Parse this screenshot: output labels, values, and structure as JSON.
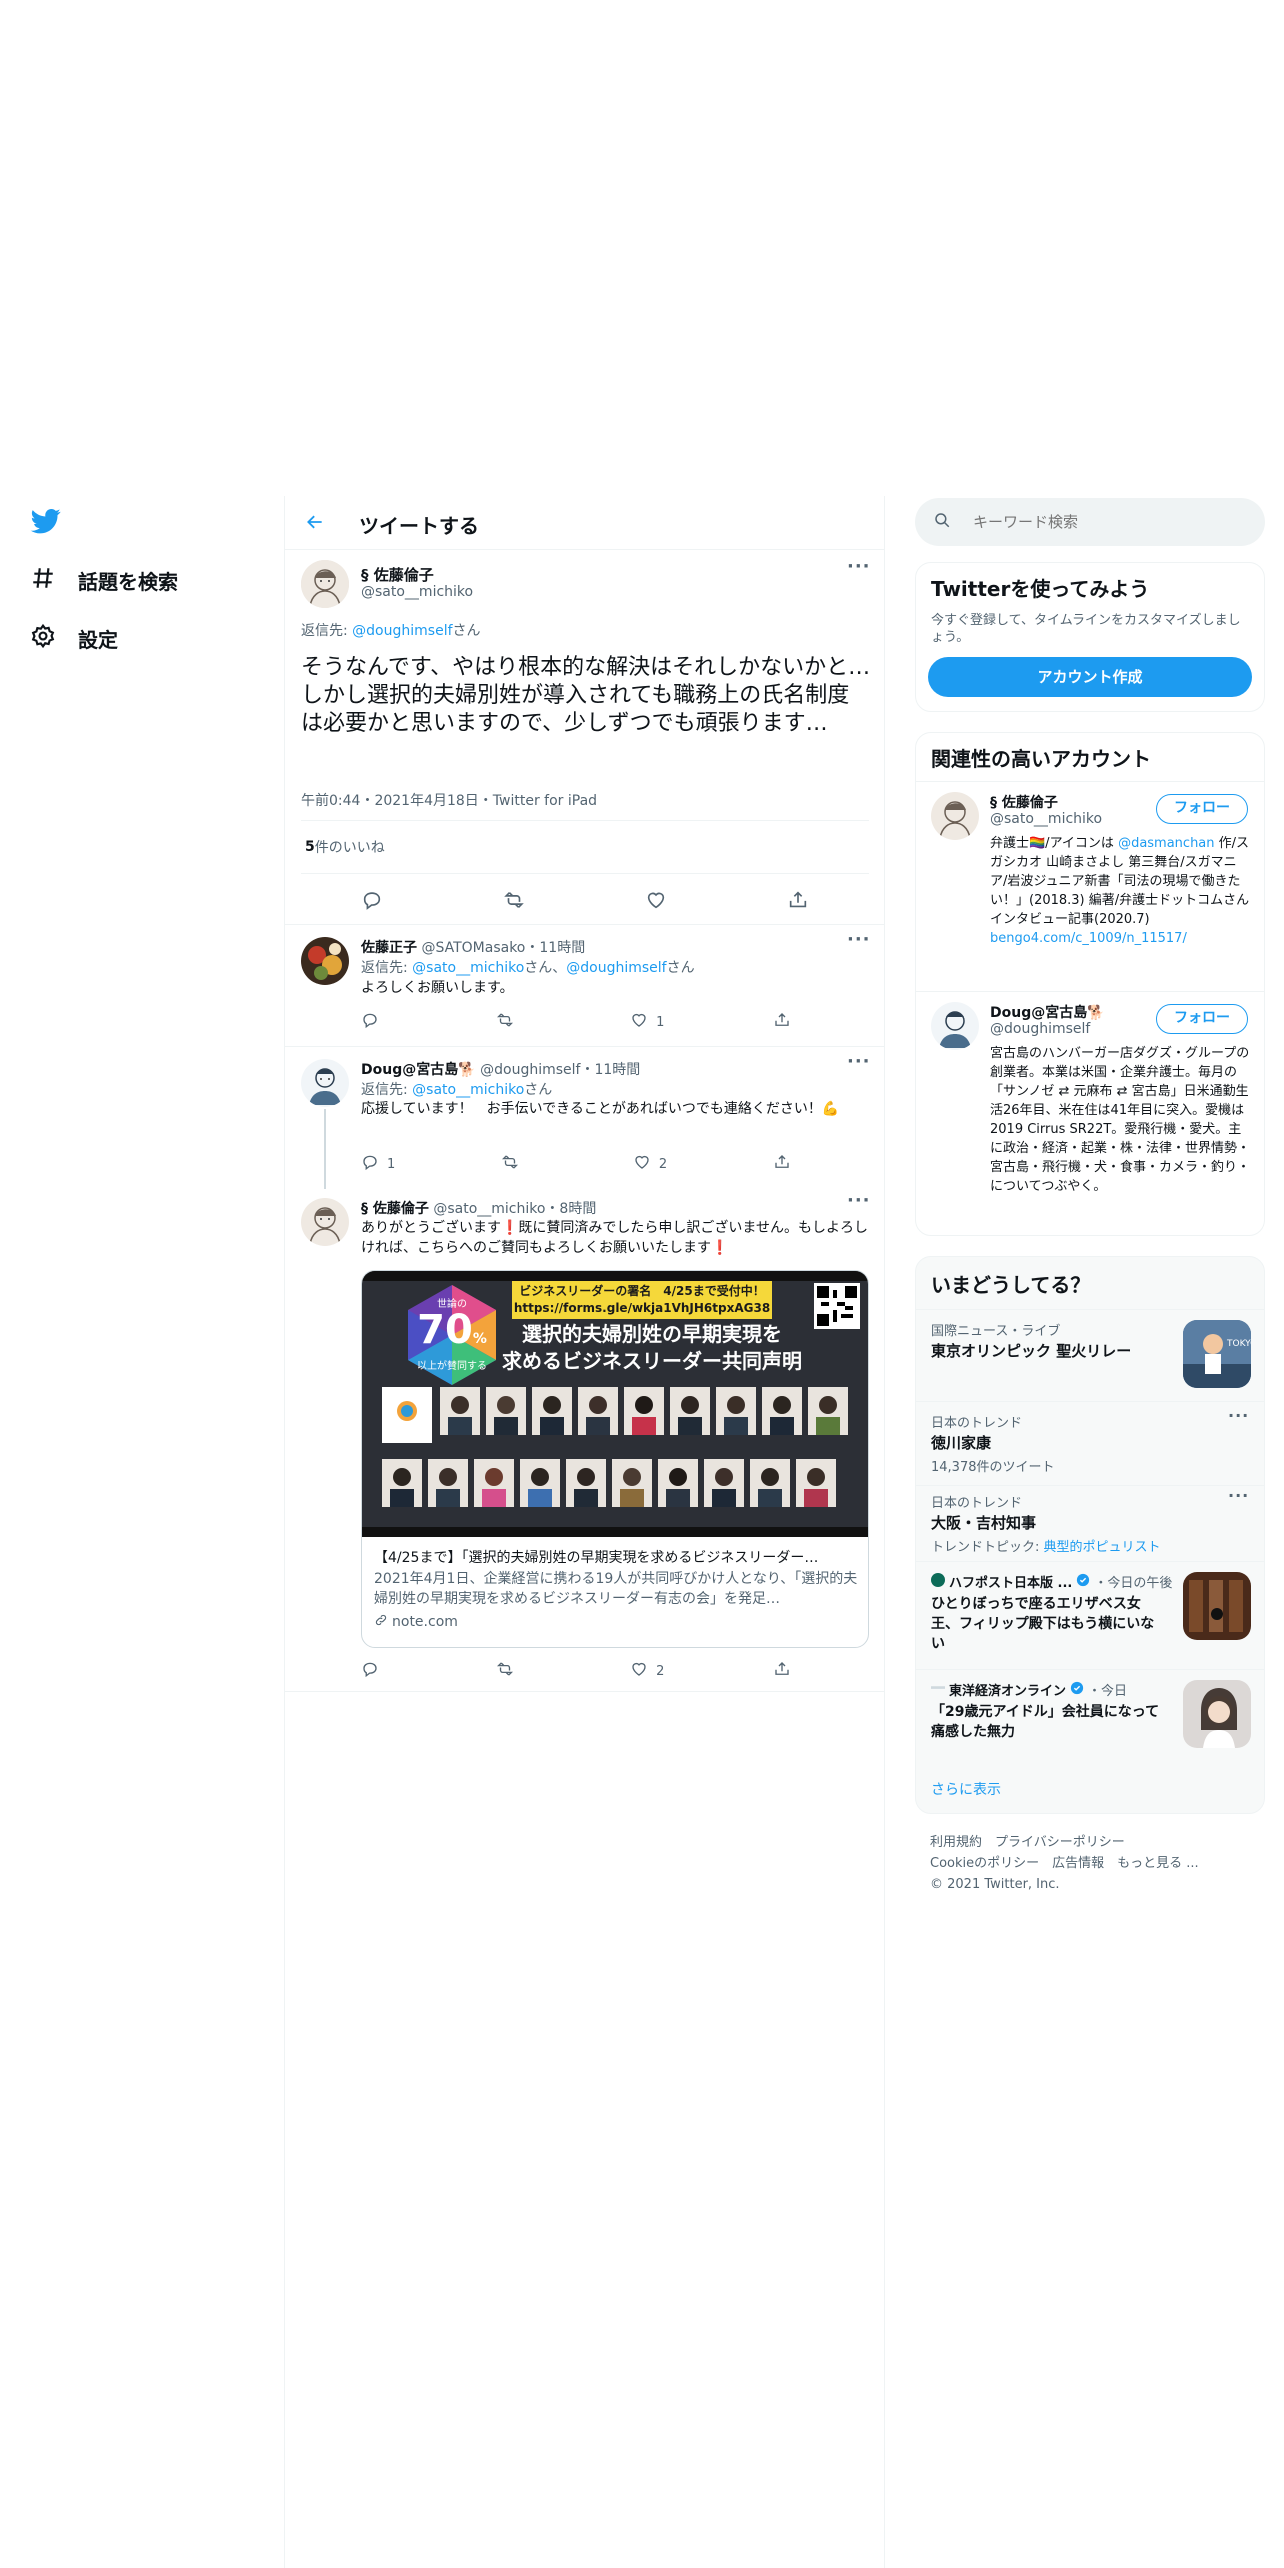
{
  "nav": {
    "items": [
      {
        "label": "話題を検索",
        "icon": "hashtag-icon"
      },
      {
        "label": "設定",
        "icon": "gear-icon"
      }
    ]
  },
  "header": {
    "title": "ツイートする"
  },
  "main_tweet": {
    "author": "§ 佐藤倫子",
    "handle": "@sato__michiko",
    "reply_prefix": "返信先: ",
    "reply_to": "@doughimself",
    "reply_suffix": "さん",
    "text": "そうなんです、やはり根本的な解決はそれしかないかと…しかし選択的夫婦別姓が導入されても職務上の氏名制度は必要かと思いますので、少しずつでも頑張ります…",
    "meta": "午前0:44・2021年4月18日・Twitter for iPad",
    "likes_count": "5",
    "likes_label": " 件のいいね"
  },
  "replies": [
    {
      "author": "佐藤正子",
      "handle": "@SATOMasako",
      "time": "・11時間",
      "reply_prefix": "返信先: ",
      "reply_to_1": "@sato__michiko",
      "reply_mid": "さん、",
      "reply_to_2": "@doughimself",
      "reply_suffix": "さん",
      "text": "よろしくお願いします。",
      "reply_count": "",
      "retweet_count": "",
      "like_count": "1"
    },
    {
      "author": "Doug@宮古島🐕",
      "handle": "@doughimself",
      "time": "・11時間",
      "reply_prefix": "返信先: ",
      "reply_to_1": "@sato__michiko",
      "reply_suffix": "さん",
      "text": "応援しています！　お手伝いできることがあればいつでも連絡ください！💪",
      "reply_count": "1",
      "retweet_count": "",
      "like_count": "2"
    },
    {
      "author": "§ 佐藤倫子",
      "handle": "@sato__michiko",
      "time": "・8時間",
      "text": "ありがとうございます❗️既に賛同済みでしたら申し訳ございません。もしよろしければ、こちらへのご賛同もよろしくお願いいたします❗️",
      "card": {
        "image_banner": "ビジネスリーダーの署名　4/25まで受付中！",
        "image_url": "https://forms.gle/wkja1VhJH6tpxAG38",
        "image_badge_top": "世論の",
        "image_badge_number": "70",
        "image_badge_pct": "%",
        "image_badge_bottom": "以上が賛同する",
        "image_headline_1": "選択的夫婦別姓の早期実現を",
        "image_headline_2": "求めるビジネスリーダー共同声明",
        "title": "【4/25まで】「選択的夫婦別姓の早期実現を求めるビジネスリーダー…",
        "description": "2021年4月1日、企業経営に携わる19人が共同呼びかけ人となり、「選択的夫婦別姓の早期実現を求めるビジネスリーダー有志の会」を発足…",
        "domain": "note.com"
      },
      "reply_count": "",
      "retweet_count": "",
      "like_count": "2"
    }
  ],
  "search": {
    "placeholder": "キーワード検索"
  },
  "signup": {
    "title": "Twitterを使ってみよう",
    "subtitle": "今すぐ登録して、タイムラインをカスタマイズしましょう。",
    "button": "アカウント作成"
  },
  "related": {
    "title": "関連性の高いアカウント",
    "accounts": [
      {
        "name": "§ 佐藤倫子",
        "handle": "@sato__michiko",
        "follow": "フォロー",
        "bio_1": "弁護士🏳️‍🌈/アイコンは ",
        "bio_link": "@dasmanchan",
        "bio_2": " 作/スガシカオ 山崎まさよし 第三舞台/スガマニア/岩波ジュニア新書「司法の現場で働きたい！」(2018.3) 編著/弁護士ドットコムさんインタビュー記事(2020.7)",
        "bio_url": "bengo4.com/c_1009/n_11517/"
      },
      {
        "name": "Doug@宮古島🐕",
        "handle": "@doughimself",
        "follow": "フォロー",
        "bio_1": "宮古島のハンバーガー店ダグズ・グループの創業者。本業は米国・企業弁護士。毎月の「サンノゼ ⇄ 元麻布 ⇄ 宮古島」日米通勤生活26年目、米在住は41年目に突入。愛機は2019 Cirrus SR22T。愛飛行機・愛犬。主に政治・経済・起業・株・法律・世界情勢・宮古島・飛行機・犬・食事・カメラ・釣り・についてつぶやく。"
      }
    ]
  },
  "trends": {
    "title": "いまどうしてる？",
    "items": [
      {
        "context": "国際ニュース・ライブ",
        "title": "東京オリンピック 聖火リレー",
        "extra": "",
        "has_thumb": true
      },
      {
        "context": "日本のトレンド",
        "title": "徳川家康",
        "extra": "14,378件のツイート",
        "has_thumb": false
      },
      {
        "context": "日本のトレンド",
        "title": "大阪・吉村知事",
        "extra_prefix": "トレンドトピック: ",
        "extra_link": "典型的ポピュリスト",
        "has_thumb": false
      },
      {
        "source": "ハフポスト日本版 ...",
        "time": "・今日の午後",
        "title": "ひとりぼっちで座るエリザベス女王、フィリップ殿下はもう横にいない",
        "has_thumb": true
      },
      {
        "source": "東洋経済オンライン",
        "time": "・今日",
        "title": "「29歳元アイドル」会社員になって痛感した無力",
        "has_thumb": true
      }
    ],
    "show_more": "さらに表示"
  },
  "footer": {
    "line1": "利用規約　プライバシーポリシー",
    "line2": "Cookieのポリシー　広告情報　もっと見る ...",
    "line3": "© 2021 Twitter, Inc."
  },
  "colors": {
    "accent": "#1d9bf0",
    "text": "#0f1419",
    "muted": "#536471",
    "border": "#eff3f4",
    "panel": "#f7f9f9"
  }
}
